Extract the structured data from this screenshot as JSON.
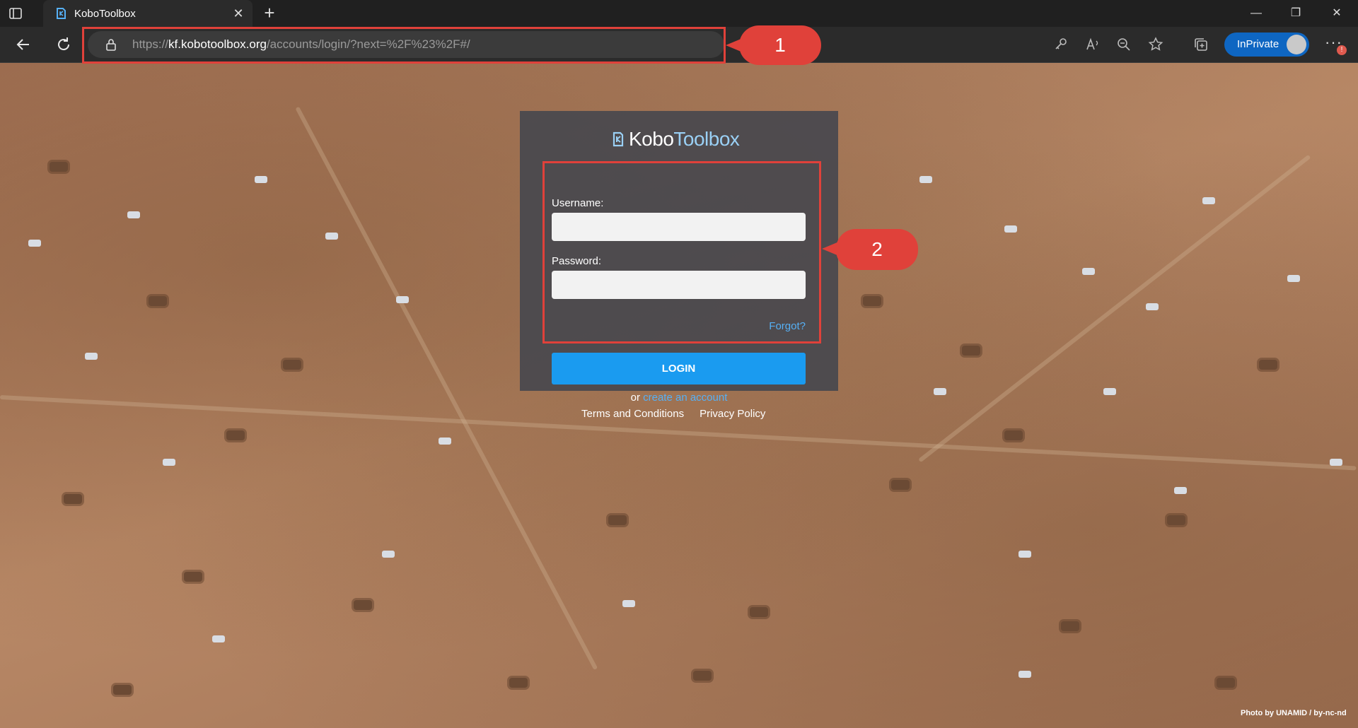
{
  "browser": {
    "tab_title": "KoboToolbox",
    "url_prefix": "https://",
    "url_domain": "kf.kobotoolbox.org",
    "url_path": "/accounts/login/?next=%2F%23%2F#/",
    "inprivate_label": "InPrivate",
    "badge_count": "!"
  },
  "login": {
    "logo_part1": "Kobo",
    "logo_part2": "Toolbox",
    "username_label": "Username:",
    "password_label": "Password:",
    "username_value": "",
    "password_value": "",
    "forgot_label": "Forgot?",
    "login_label": "LOGIN",
    "create_prefix": "or",
    "create_link": "create an account"
  },
  "footer": {
    "terms": "Terms and Conditions",
    "privacy": "Privacy Policy",
    "photo_credit": "Photo by UNAMID / by-nc-nd"
  },
  "annotations": {
    "callout1": "1",
    "callout2": "2"
  },
  "colors": {
    "accent": "#1a9bf0",
    "link": "#56b0f5",
    "annotation": "#e0413a",
    "inprivate": "#0e66c2"
  }
}
